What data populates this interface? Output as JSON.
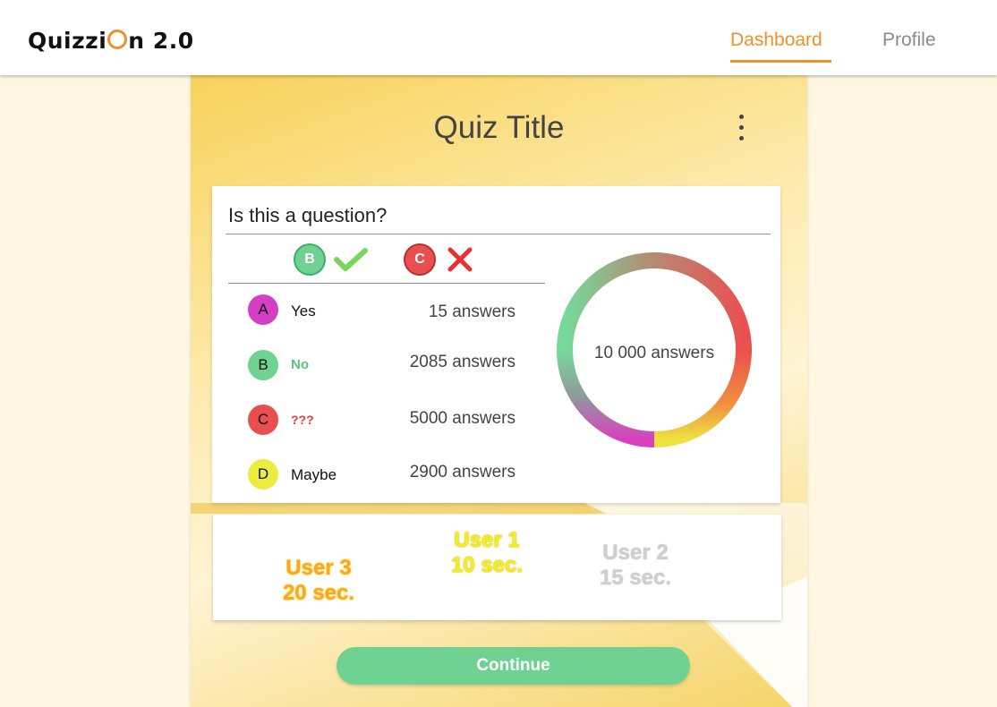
{
  "app": {
    "logo_prefix": "Quizzi",
    "logo_suffix": "n 2.0",
    "accent_color": "#f0902b"
  },
  "nav": {
    "items": [
      {
        "label": "Dashboard",
        "active": true
      },
      {
        "label": "Profile",
        "active": false
      }
    ]
  },
  "quiz": {
    "title": "Quiz Title",
    "menu_icon": "more-vertical-icon"
  },
  "question": {
    "text": "Is this a question?",
    "correct": {
      "letter": "B",
      "icon": "check-icon",
      "color": "#6fd292"
    },
    "wrong": {
      "letter": "C",
      "icon": "cross-icon",
      "color": "#e94f4f"
    },
    "options": [
      {
        "letter": "A",
        "text": "Yes",
        "answers": "15 answers",
        "color": "#d63fc3",
        "text_color": "#111111"
      },
      {
        "letter": "B",
        "text": "No",
        "answers": "2085 answers",
        "color": "#6fd292",
        "text_color": "#52c67f"
      },
      {
        "letter": "C",
        "text": "???",
        "answers": "5000 answers",
        "color": "#e94f4f",
        "text_color": "#e23b3b"
      },
      {
        "letter": "D",
        "text": "Maybe",
        "answers": "2900 answers",
        "color": "#ecec3e",
        "text_color": "#111111"
      }
    ],
    "total_label": "10 000 answers"
  },
  "leaderboard": {
    "entries": [
      {
        "user": "User 3",
        "time": "20 sec.",
        "style": "orange"
      },
      {
        "user": "User 1",
        "time": "10 sec.",
        "style": "yellow"
      },
      {
        "user": "User 2",
        "time": "15 sec.",
        "style": "silver"
      }
    ]
  },
  "actions": {
    "continue_label": "Continue",
    "continue_color": "#6fd292"
  }
}
